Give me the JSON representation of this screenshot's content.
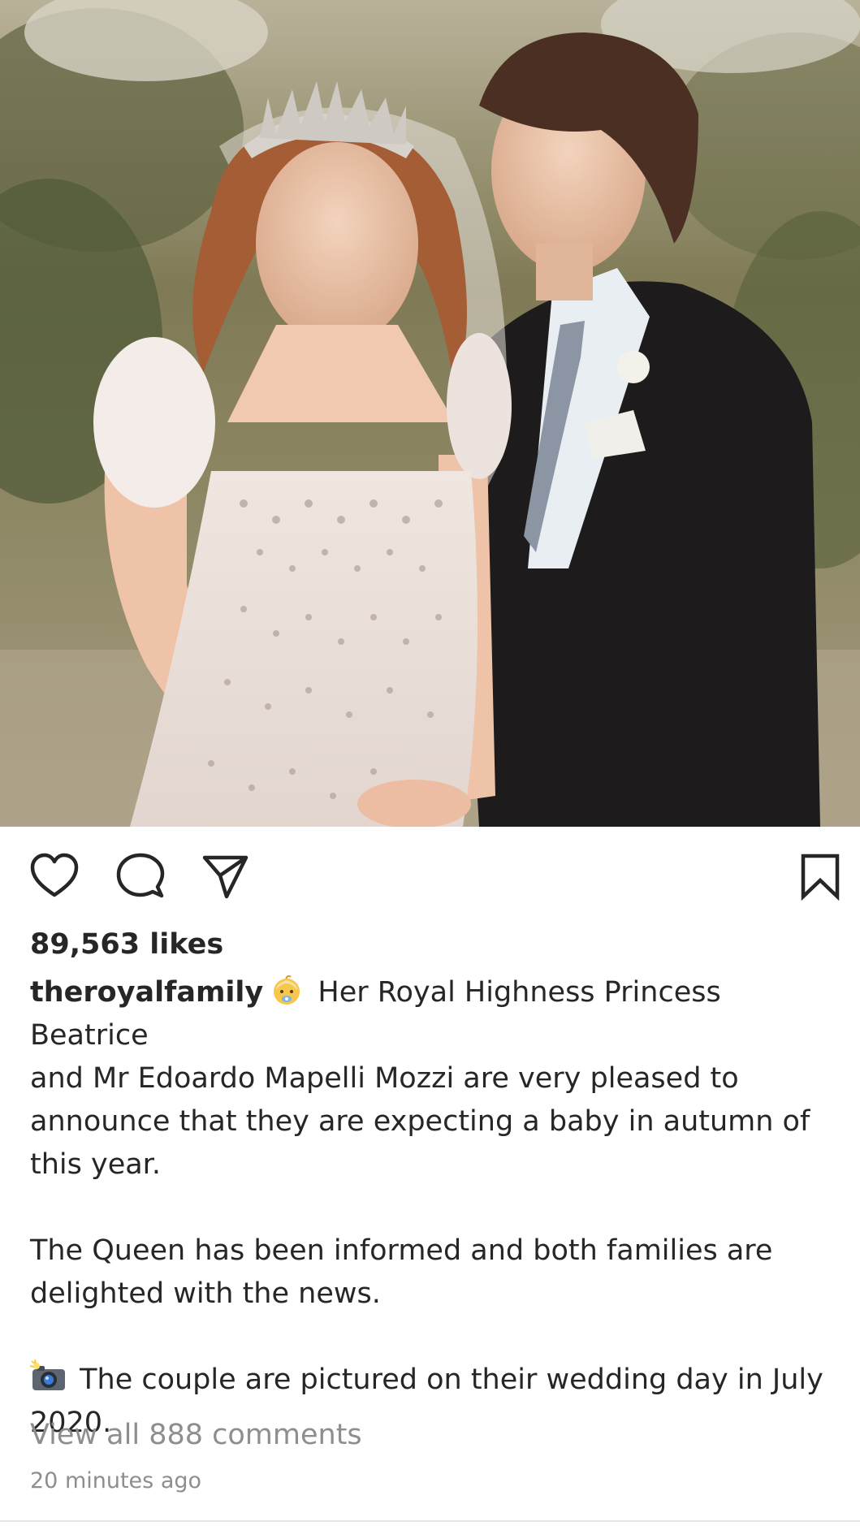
{
  "post": {
    "image_alt": "",
    "likes_text": "89,563 likes",
    "username": "theroyalfamily",
    "caption": {
      "emoji_baby": "baby-emoji",
      "line_1": " Her Royal Highness Princess Beatrice",
      "line_2": "and Mr Edoardo Mapelli Mozzi are very pleased to",
      "line_3": "announce that they are expecting a baby in autumn of",
      "line_4": "this year.",
      "para_2_line_1": "The Queen has been informed and both families are",
      "para_2_line_2": "delighted with the news.",
      "emoji_camera": "camera-with-flash-emoji",
      "para_3_line_1": " The couple are pictured on their wedding day in July",
      "para_3_line_2": "2020."
    },
    "view_comments_text": "View all 888 comments",
    "timestamp": "20 minutes ago"
  },
  "icons": {
    "like": "heart-outline-icon",
    "comment": "comment-bubble-icon",
    "share": "paper-plane-icon",
    "save": "bookmark-outline-icon"
  },
  "colors": {
    "text": "#262626",
    "secondary_text": "#8e8e8e",
    "background": "#ffffff"
  }
}
